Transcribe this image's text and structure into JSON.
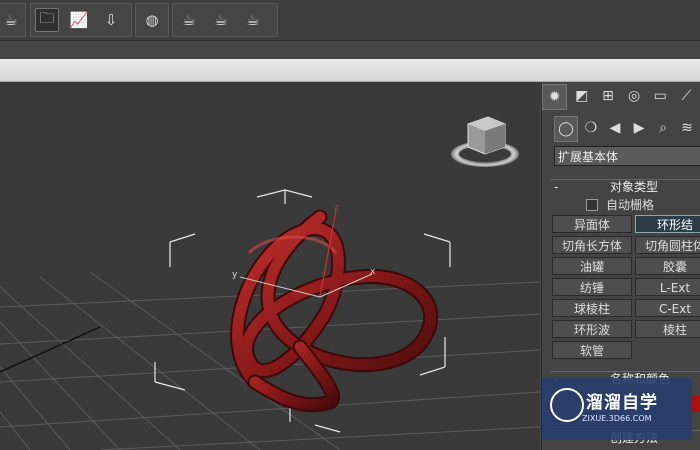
{
  "toolbar": {
    "icons": [
      "teapot-partial-icon",
      "open-folder-icon",
      "curve-editor-icon",
      "render-setup-icon",
      "material-editor-icon",
      "render-frame-icon",
      "render-icon",
      "quick-render-icon"
    ]
  },
  "viewport": {
    "axis_labels": {
      "x": "x",
      "y": "y",
      "z": "z"
    },
    "object_color": "#8b1a1a"
  },
  "command_panel": {
    "tabs_row1": [
      "create-tab",
      "modify-tab",
      "hierarchy-tab",
      "motion-tab",
      "display-tab",
      "utilities-tab"
    ],
    "tabs_row2": [
      "geometry-icon",
      "shapes-icon",
      "lights-icon",
      "cameras-icon",
      "helpers-icon",
      "spacewarps-icon"
    ],
    "category_dropdown": "扩展基本体",
    "object_type": {
      "title": "对象类型",
      "toggle": "-",
      "autogrid_label": "自动栅格",
      "buttons": [
        "异面体",
        "环形结",
        "切角长方体",
        "切角圆柱体",
        "油罐",
        "胶囊",
        "纺锤",
        "L-Ext",
        "球棱柱",
        "C-Ext",
        "环形波",
        "棱柱",
        "软管"
      ],
      "selected": "环形结"
    },
    "name_color": {
      "title": "名称和颜色",
      "toggle": "-",
      "swatch_color": "#a11111"
    },
    "creation_method": {
      "title": "创建方法"
    }
  },
  "watermark": {
    "brand": "溜溜自学",
    "url": "ZIXUE.3D66.COM"
  }
}
